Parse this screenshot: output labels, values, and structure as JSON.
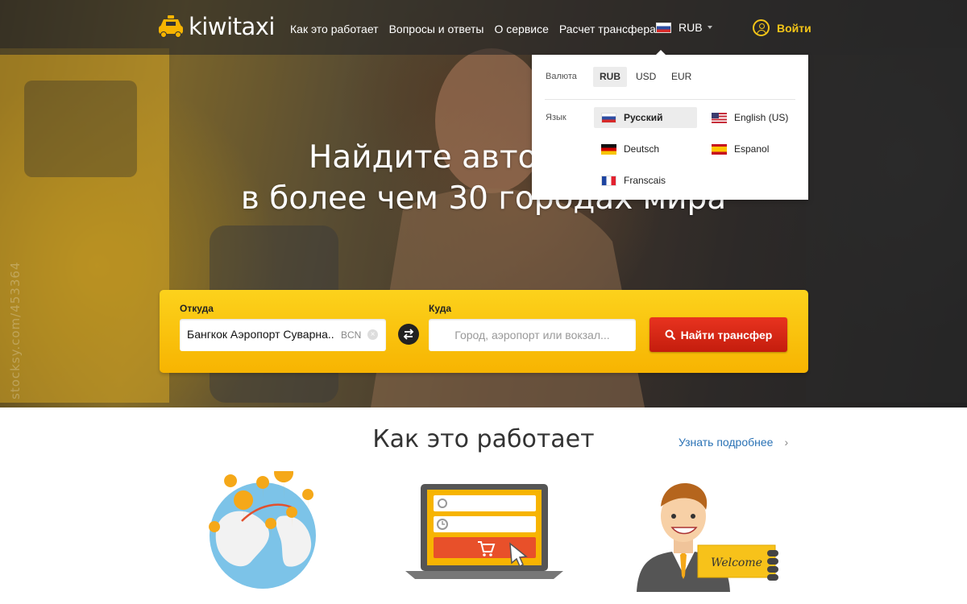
{
  "header": {
    "logo_text": "kiwitaxi",
    "nav": [
      "Как это работает",
      "Вопросы и ответы",
      "О сервисе",
      "Расчет трансфера"
    ],
    "currency_selected": "RUB",
    "login_label": "Войти"
  },
  "dropdown": {
    "currency_label": "Валюта",
    "currencies": [
      "RUB",
      "USD",
      "EUR"
    ],
    "language_label": "Язык",
    "languages": [
      "Русский",
      "English (US)",
      "Deutsch",
      "Espanol",
      "Franscais"
    ]
  },
  "hero": {
    "headline_line1": "Найдите автомобиль",
    "headline_line2": "в более чем 30 городах мира",
    "watermark": "stocksy.com/453364"
  },
  "search": {
    "from_label": "Откуда",
    "from_value": "Бангкок Аэропорт Суварна..",
    "from_code": "BCN",
    "to_label": "Куда",
    "to_placeholder": "Город, аэропорт или вокзал...",
    "button_label": "Найти трансфер"
  },
  "how": {
    "title": "Как это работает",
    "more_link": "Узнать подробнее",
    "welcome_sign": "Welcome"
  },
  "colors": {
    "accent_yellow": "#f7b401",
    "button_red": "#d4261a",
    "link_blue": "#2a72b5"
  }
}
